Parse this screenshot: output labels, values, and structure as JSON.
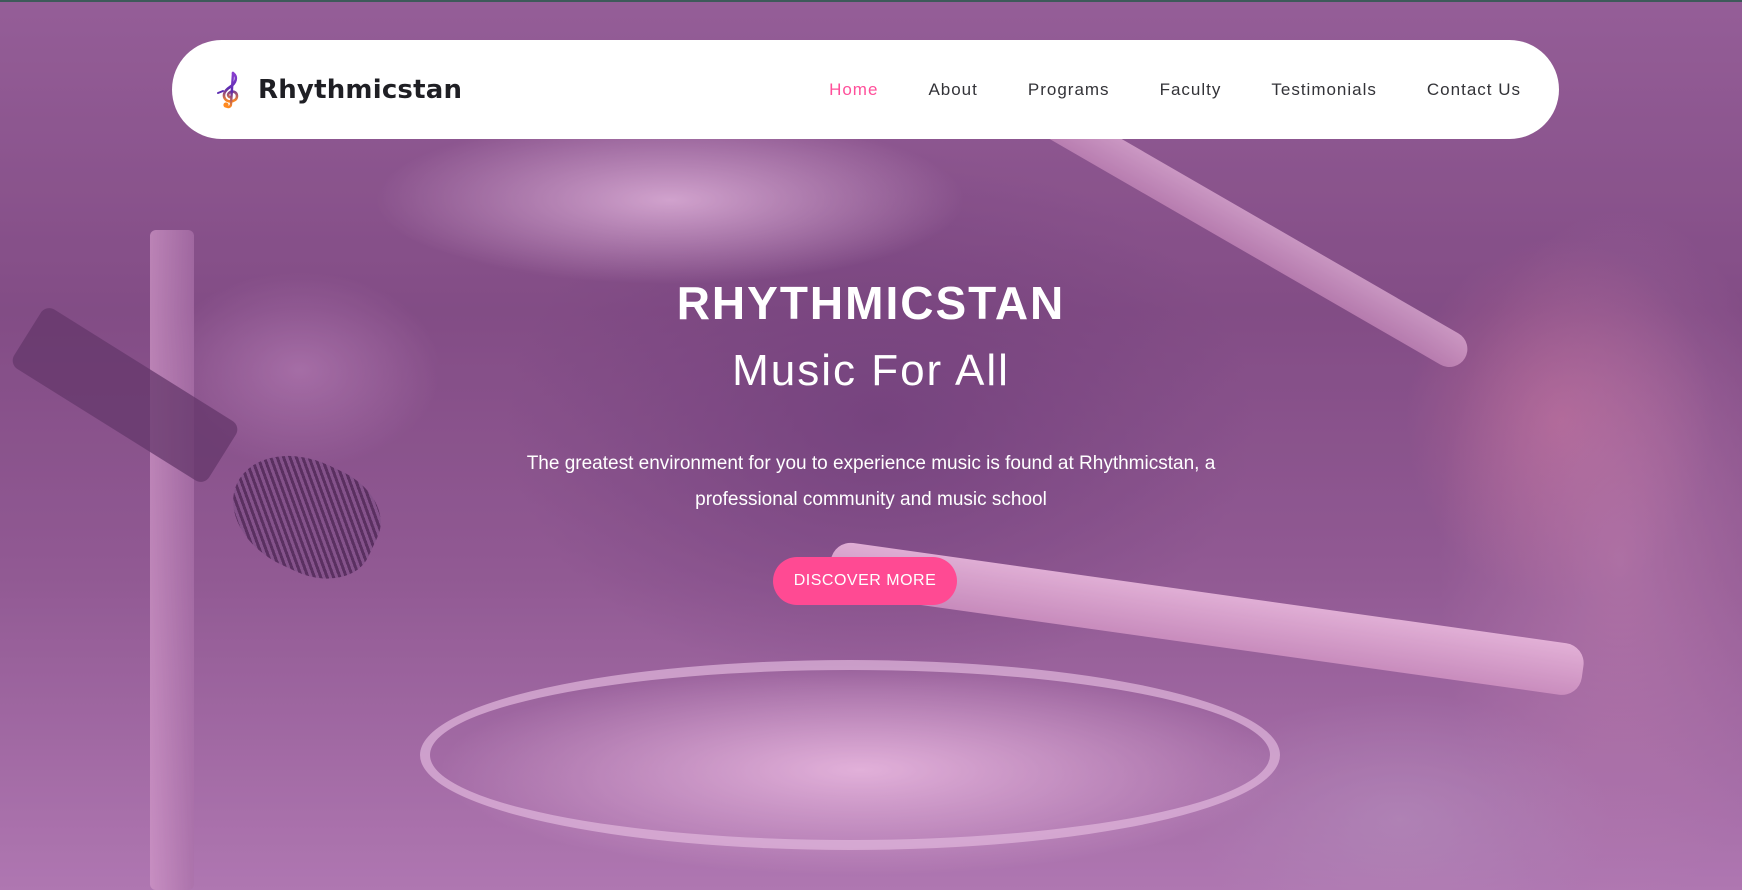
{
  "brand": {
    "name": "Rhythmicstan",
    "icon": "treble-clef-icon"
  },
  "nav": {
    "items": [
      {
        "label": "Home",
        "active": true
      },
      {
        "label": "About",
        "active": false
      },
      {
        "label": "Programs",
        "active": false
      },
      {
        "label": "Faculty",
        "active": false
      },
      {
        "label": "Testimonials",
        "active": false
      },
      {
        "label": "Contact Us",
        "active": false
      }
    ]
  },
  "hero": {
    "title": "RHYTHMICSTAN",
    "subtitle": "Music For All",
    "description": "The greatest environment for you to experience music is found at Rhythmicstan, a professional community and music school",
    "button_label": "DISCOVER MORE",
    "background": "drummer-with-drums-photo"
  },
  "colors": {
    "accent": "#ff4a93",
    "nav_active": "#ff4f9a",
    "overlay": "#b066aa"
  }
}
